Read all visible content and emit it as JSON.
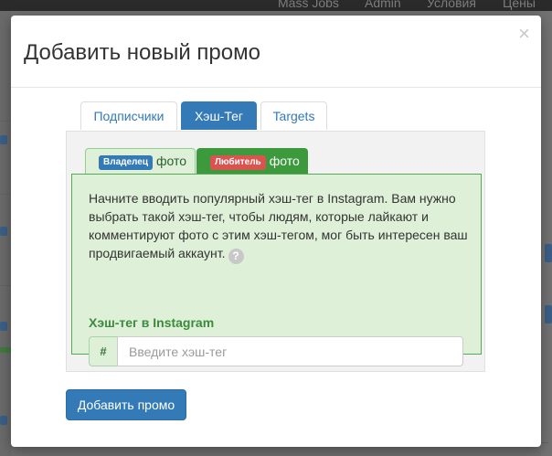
{
  "background_nav": {
    "items": [
      "Mass Jobs",
      "Admin",
      "Условия",
      "Цены"
    ]
  },
  "modal": {
    "title": "Добавить новый промо",
    "close_symbol": "×"
  },
  "main_tabs": [
    {
      "label": "Подписчики",
      "active": false
    },
    {
      "label": "Хэш-Тег",
      "active": true
    },
    {
      "label": "Targets",
      "active": false
    }
  ],
  "sub_tabs": [
    {
      "badge": "Владелец",
      "badge_color": "#337ab7",
      "label": "фото",
      "active": false
    },
    {
      "badge": "Любитель",
      "badge_color": "#d9534f",
      "label": "фото",
      "active": true
    }
  ],
  "hashtag_section": {
    "description": "Начните вводить популярный хэш-тег в Instagram. Вам нужно выбрать такой хэш-тег, чтобы людям, которые лайкают и комментируют фото с этим хэш-тегом, мог быть интересен ваш продвигаемый аккаунт.",
    "help_symbol": "?",
    "field_label": "Хэш-тег в Instagram",
    "input_prefix": "#",
    "input_placeholder": "Введите хэш-тег",
    "input_value": ""
  },
  "submit_label": "Добавить промо",
  "colors": {
    "primary": "#337ab7",
    "success_bg": "#dff0d8",
    "success_border": "#57a957",
    "danger": "#d9534f"
  }
}
